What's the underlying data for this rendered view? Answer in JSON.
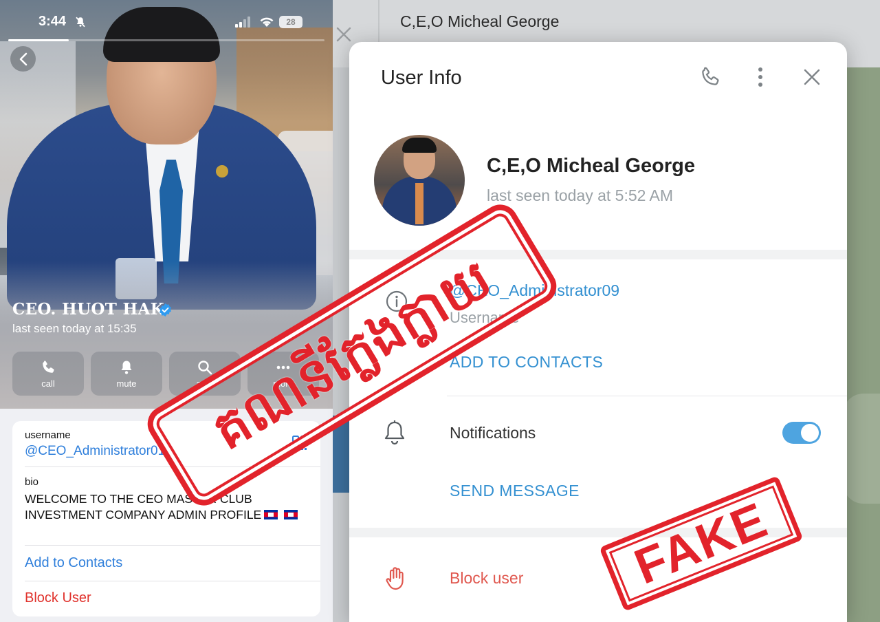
{
  "phone": {
    "status_time": "3:44",
    "battery": "28",
    "profile_name": "CEO. HUOT HAK",
    "last_seen": "last seen today at 15:35",
    "actions": [
      {
        "label": "call",
        "icon": "phone-icon"
      },
      {
        "label": "mute",
        "icon": "bell-icon"
      },
      {
        "label": "arch",
        "icon": "search-icon"
      },
      {
        "label": "more",
        "icon": "more-icon"
      }
    ],
    "username_label": "username",
    "username": "@CEO_Administrator01",
    "bio_label": "bio",
    "bio": "WELCOME TO THE CEO MASTER CLUB INVESTMENT COMPANY ADMIN PROFILE",
    "add_to_contacts": "Add to Contacts",
    "block_user": "Block User"
  },
  "desktop": {
    "chat_title": "C,E,O Micheal George",
    "modal": {
      "title": "User Info",
      "name": "C,E,O Micheal George",
      "last_seen": "last seen today at 5:52 AM",
      "username": "@CEO_Administrator09",
      "username_label": "Username",
      "add_to_contacts": "ADD TO CONTACTS",
      "notifications": "Notifications",
      "notifications_on": true,
      "send_message": "SEND MESSAGE",
      "block_user": "Block user"
    }
  },
  "stamps": {
    "khmer": "គណនីក្លែងក្លាយ",
    "fake": "FAKE"
  },
  "colors": {
    "link_blue": "#3390d1",
    "ios_blue": "#2f7fdb",
    "stamp_red": "#e2232b",
    "danger_red": "#e0584f"
  }
}
